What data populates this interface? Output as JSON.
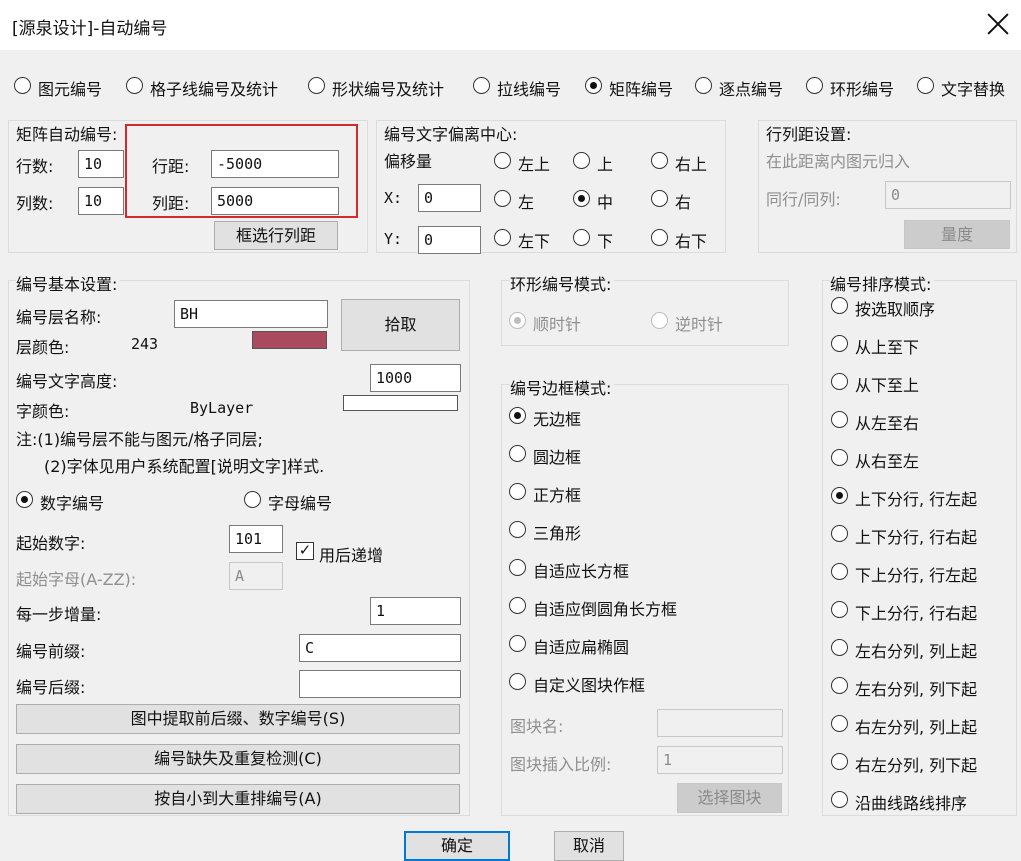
{
  "window": {
    "title": "[源泉设计]-自动编号"
  },
  "mode_tabs": [
    {
      "label": "图元编号",
      "selected": false
    },
    {
      "label": "格子线编号及统计",
      "selected": false
    },
    {
      "label": "形状编号及统计",
      "selected": false
    },
    {
      "label": "拉线编号",
      "selected": false
    },
    {
      "label": "矩阵编号",
      "selected": true
    },
    {
      "label": "逐点编号",
      "selected": false
    },
    {
      "label": "环形编号",
      "selected": false
    },
    {
      "label": "文字替换",
      "selected": false
    }
  ],
  "matrix": {
    "title": "矩阵自动编号:",
    "rows_label": "行数:",
    "rows_value": "10",
    "cols_label": "列数:",
    "cols_value": "10",
    "row_spacing_label": "行距:",
    "row_spacing_value": "-5000",
    "col_spacing_label": "列距:",
    "col_spacing_value": "5000",
    "select_button": "框选行列距"
  },
  "offset": {
    "title": "编号文字偏离中心:",
    "offset_label": "偏移量",
    "x_label": "X:",
    "x_value": "0",
    "y_label": "Y:",
    "y_value": "0",
    "positions": [
      {
        "label": "左上",
        "selected": false
      },
      {
        "label": "上",
        "selected": false
      },
      {
        "label": "右上",
        "selected": false
      },
      {
        "label": "左",
        "selected": false
      },
      {
        "label": "中",
        "selected": true
      },
      {
        "label": "右",
        "selected": false
      },
      {
        "label": "左下",
        "selected": false
      },
      {
        "label": "下",
        "selected": false
      },
      {
        "label": "右下",
        "selected": false
      }
    ]
  },
  "rowcol": {
    "title": "行列距设置:",
    "hint": "在此距离内图元归入",
    "same_label": "同行/同列:",
    "same_value": "0",
    "measure_button": "量度"
  },
  "basic": {
    "title": "编号基本设置:",
    "layer_label": "编号层名称:",
    "layer_value": "BH",
    "pick_button": "拾取",
    "layer_color_label": "层颜色:",
    "layer_color_value": "243",
    "layer_color_hex": "#a94a5e",
    "text_height_label": "编号文字高度:",
    "text_height_value": "1000",
    "font_color_label": "字颜色:",
    "font_color_value": "ByLayer",
    "note1": "注:(1)编号层不能与图元/格子同层;",
    "note2": "(2)字体见用户系统配置[说明文字]样式.",
    "numeric_label": "数字编号",
    "numeric_selected": true,
    "alpha_label": "字母编号",
    "alpha_selected": false,
    "start_num_label": "起始数字:",
    "start_num_value": "101",
    "increment_after_label": "用后递增",
    "increment_after_checked": true,
    "start_letter_label": "起始字母(A-ZZ):",
    "start_letter_value": "A",
    "step_label": "每一步增量:",
    "step_value": "1",
    "prefix_label": "编号前缀:",
    "prefix_value": "C",
    "suffix_label": "编号后缀:",
    "suffix_value": "",
    "extract_button": "图中提取前后缀、数字编号(S)",
    "check_button": "编号缺失及重复检测(C)",
    "renumber_button": "按自小到大重排编号(A)"
  },
  "ring": {
    "title": "环形编号模式:",
    "cw_label": "顺时针",
    "cw_selected": true,
    "ccw_label": "逆时针",
    "ccw_selected": false
  },
  "frame": {
    "title": "编号边框模式:",
    "options": [
      {
        "label": "无边框",
        "selected": true
      },
      {
        "label": "圆边框",
        "selected": false
      },
      {
        "label": "正方框",
        "selected": false
      },
      {
        "label": "三角形",
        "selected": false
      },
      {
        "label": "自适应长方框",
        "selected": false
      },
      {
        "label": "自适应倒圆角长方框",
        "selected": false
      },
      {
        "label": "自适应扁椭圆",
        "selected": false
      },
      {
        "label": "自定义图块作框",
        "selected": false
      }
    ],
    "block_name_label": "图块名:",
    "block_name_value": "",
    "block_scale_label": "图块插入比例:",
    "block_scale_value": "1",
    "select_block_button": "选择图块"
  },
  "sort": {
    "title": "编号排序模式:",
    "options": [
      {
        "label": "按选取顺序",
        "selected": false
      },
      {
        "label": "从上至下",
        "selected": false
      },
      {
        "label": "从下至上",
        "selected": false
      },
      {
        "label": "从左至右",
        "selected": false
      },
      {
        "label": "从右至左",
        "selected": false
      },
      {
        "label": "上下分行, 行左起",
        "selected": true
      },
      {
        "label": "上下分行, 行右起",
        "selected": false
      },
      {
        "label": "下上分行, 行左起",
        "selected": false
      },
      {
        "label": "下上分行, 行右起",
        "selected": false
      },
      {
        "label": "左右分列, 列上起",
        "selected": false
      },
      {
        "label": "左右分列, 列下起",
        "selected": false
      },
      {
        "label": "右左分列, 列上起",
        "selected": false
      },
      {
        "label": "右左分列, 列下起",
        "selected": false
      },
      {
        "label": "沿曲线路线排序",
        "selected": false
      }
    ]
  },
  "footer": {
    "ok": "确定",
    "cancel": "取消"
  },
  "icons": {
    "close": "close-icon"
  },
  "colors": {
    "highlight": "#d22b2b",
    "default_button_border": "#0078d7"
  }
}
